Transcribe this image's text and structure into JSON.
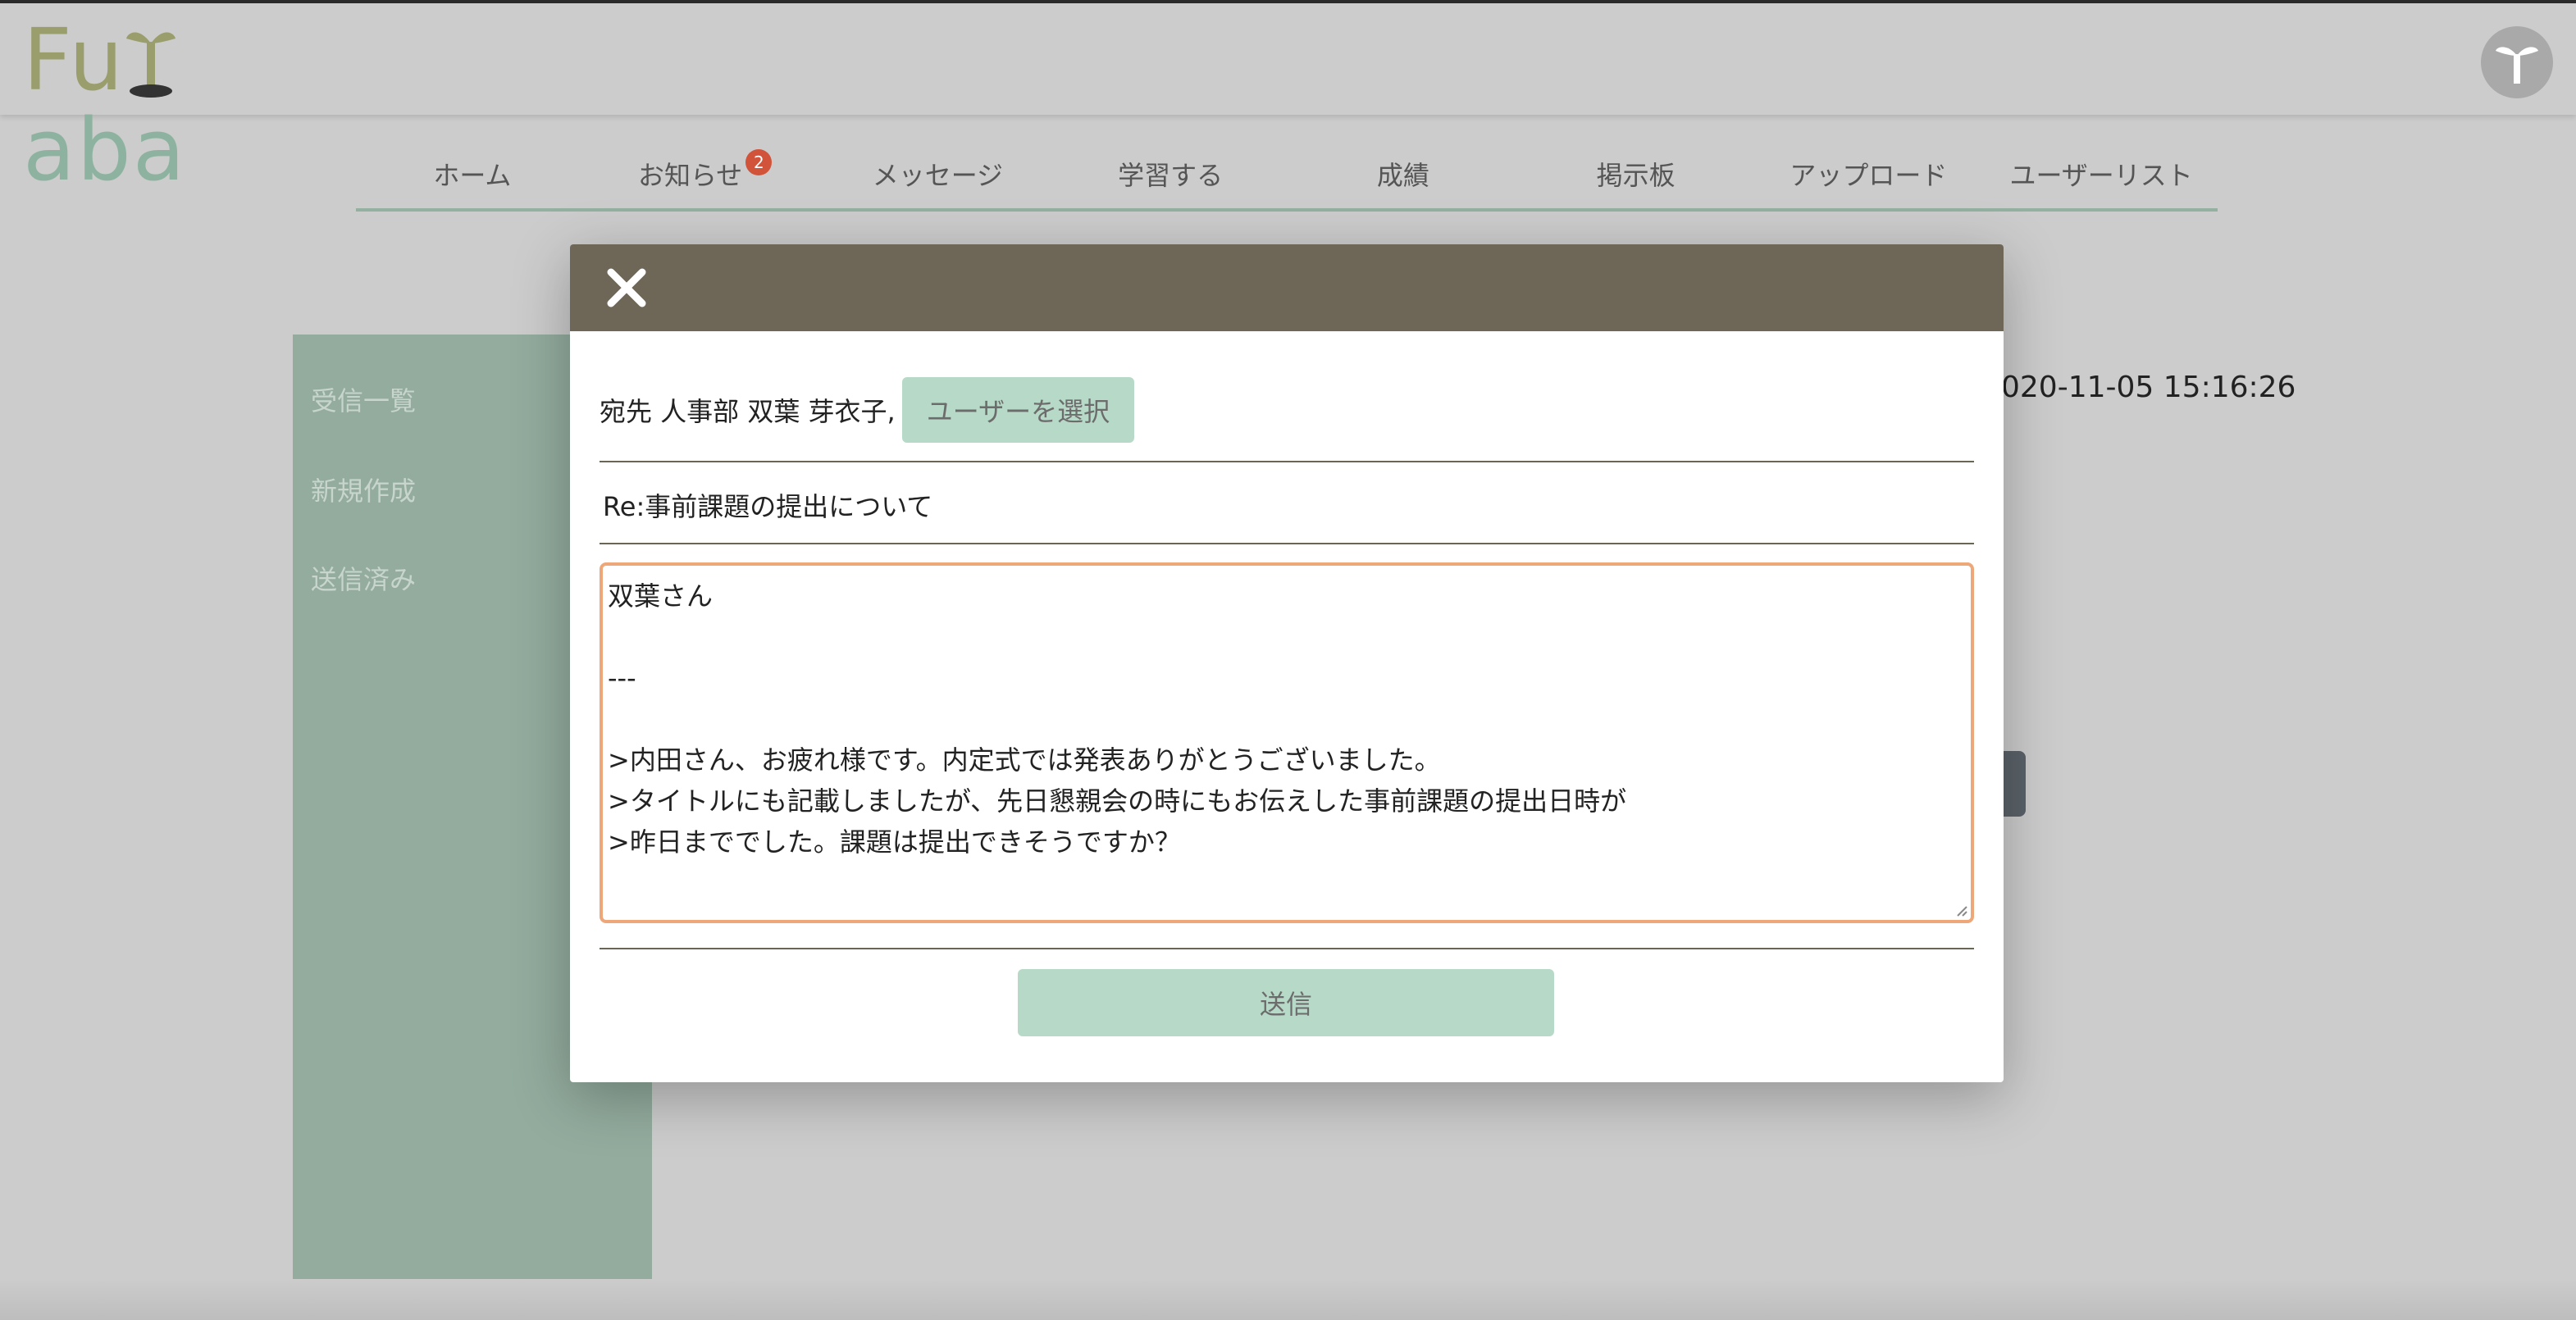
{
  "app": {
    "logo_text_a": "Fu",
    "logo_text_b": "aba"
  },
  "nav": {
    "items": [
      {
        "label": "ホーム"
      },
      {
        "label": "お知らせ",
        "badge": "2"
      },
      {
        "label": "メッセージ"
      },
      {
        "label": "学習する"
      },
      {
        "label": "成績"
      },
      {
        "label": "掲示板"
      },
      {
        "label": "アップロード"
      },
      {
        "label": "ユーザーリスト"
      }
    ]
  },
  "sidebar": {
    "items": [
      {
        "label": "受信一覧"
      },
      {
        "label": "新規作成"
      },
      {
        "label": "送信済み"
      }
    ]
  },
  "background": {
    "timestamp": "020-11-05 15:16:26"
  },
  "modal": {
    "recipient_label": "宛先 人事部 双葉 芽衣子,",
    "select_user_label": "ユーザーを選択",
    "subject": "Re:事前課題の提出について",
    "body_lines": [
      "双葉さん",
      "",
      "---",
      "",
      ">内田さん、お疲れ様です。内定式では発表ありがとうございました。",
      ">タイトルにも記載しましたが、先日懇親会の時にもお伝えした事前課題の提出日時が",
      ">昨日まででした。課題は提出できそうですか？"
    ],
    "send_label": "送信"
  },
  "colors": {
    "header_bar": "#6e6758",
    "accent_green": "#b7d9c8",
    "sidebar_green": "#93ac9e",
    "focus_orange": "#eea779",
    "badge_red": "#d0533a"
  }
}
